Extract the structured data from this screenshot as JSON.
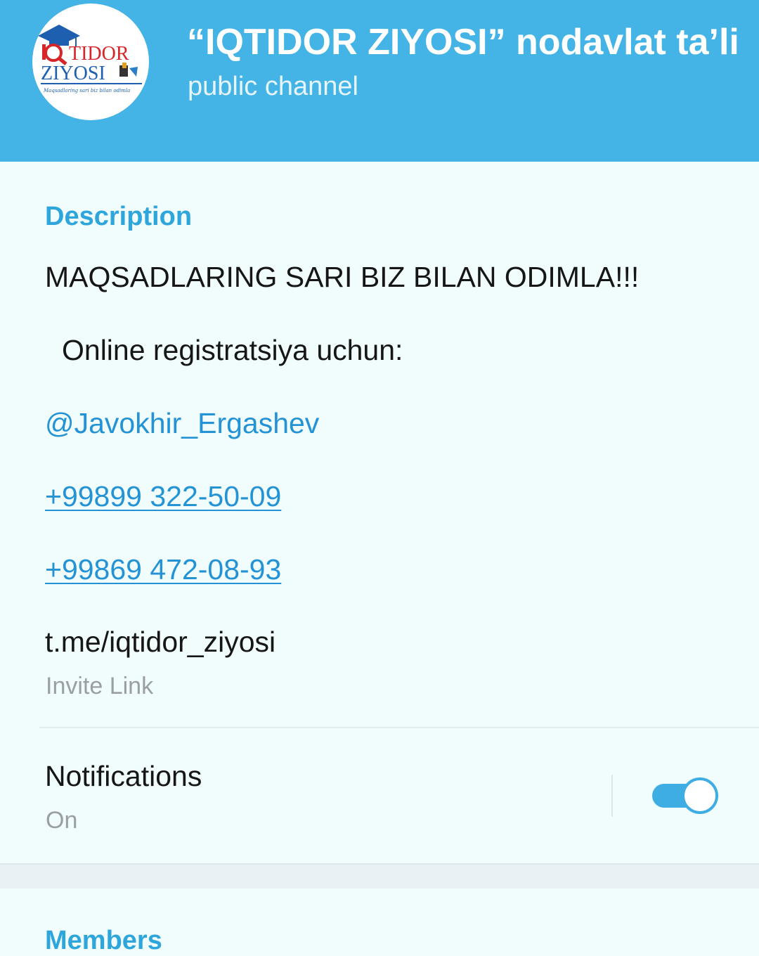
{
  "header": {
    "title": "“IQTIDOR ZIYOSI” nodavlat ta’lim",
    "subtitle": "public channel",
    "avatar": {
      "logo_line1": "TIDOR",
      "logo_line2": "ZIYOSI",
      "tagline": "Maqsadlaring sari biz bilan odimla"
    },
    "background_color": "#44b3e6"
  },
  "description": {
    "heading": "Description",
    "motto": "MAQSADLARING SARI BIZ BILAN ODIMLA!!!",
    "registration": "Online registratsiya uchun:",
    "username": "@Javokhir_Ergashev",
    "phone1": "+99899 322-50-09",
    "phone2": "+99869 472-08-93"
  },
  "invite": {
    "link": "t.me/iqtidor_ziyosi",
    "label": "Invite Link"
  },
  "notifications": {
    "label": "Notifications",
    "status": "On",
    "enabled": true,
    "accent_color": "#3dade3"
  },
  "members": {
    "heading": "Members"
  }
}
